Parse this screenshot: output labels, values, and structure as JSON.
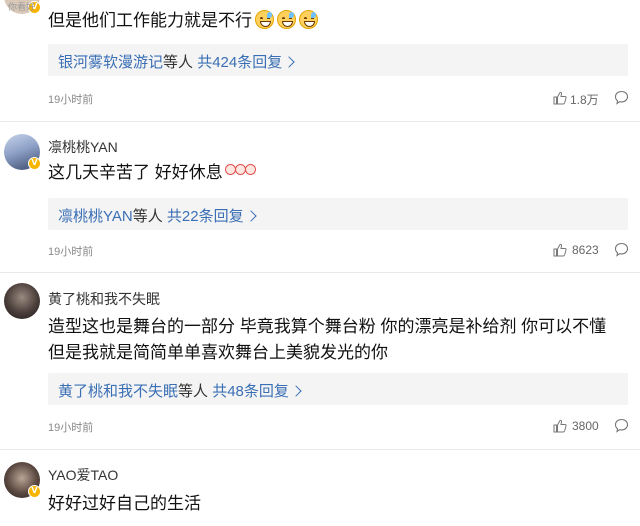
{
  "comments": [
    {
      "username": "你看好",
      "text": "但是他们工作能力就是不行",
      "reply_name": "银河雾软漫游记",
      "reply_mid": "等人",
      "reply_count": "共424条回复",
      "time": "19小时前",
      "likes": "1.8万"
    },
    {
      "username": "凛桃桃YAN",
      "text": "这几天辛苦了 好好休息",
      "reply_name": "凛桃桃YAN",
      "reply_mid": "等人",
      "reply_count": "共22条回复",
      "time": "19小时前",
      "likes": "8623"
    },
    {
      "username": "黄了桃和我不失眠",
      "text_line1": "造型这也是舞台的一部分 毕竟我算个舞台粉 你的漂亮是补给剂 你可以不懂",
      "text_line2": "但是我就是简简单单喜欢舞台上美貌发光的你",
      "reply_name": "黄了桃和我不失眠",
      "reply_mid": "等人",
      "reply_count": "共48条回复",
      "time": "19小时前",
      "likes": "3800"
    },
    {
      "username": "YAO爱TAO",
      "text": "好好过好自己的生活"
    }
  ],
  "icons": {
    "like": "thumbs-up-icon",
    "comment": "comment-bubble-icon",
    "verified": "verified-badge-icon"
  },
  "colors": {
    "link": "#3a6fb5",
    "badge": "#f7b500"
  }
}
